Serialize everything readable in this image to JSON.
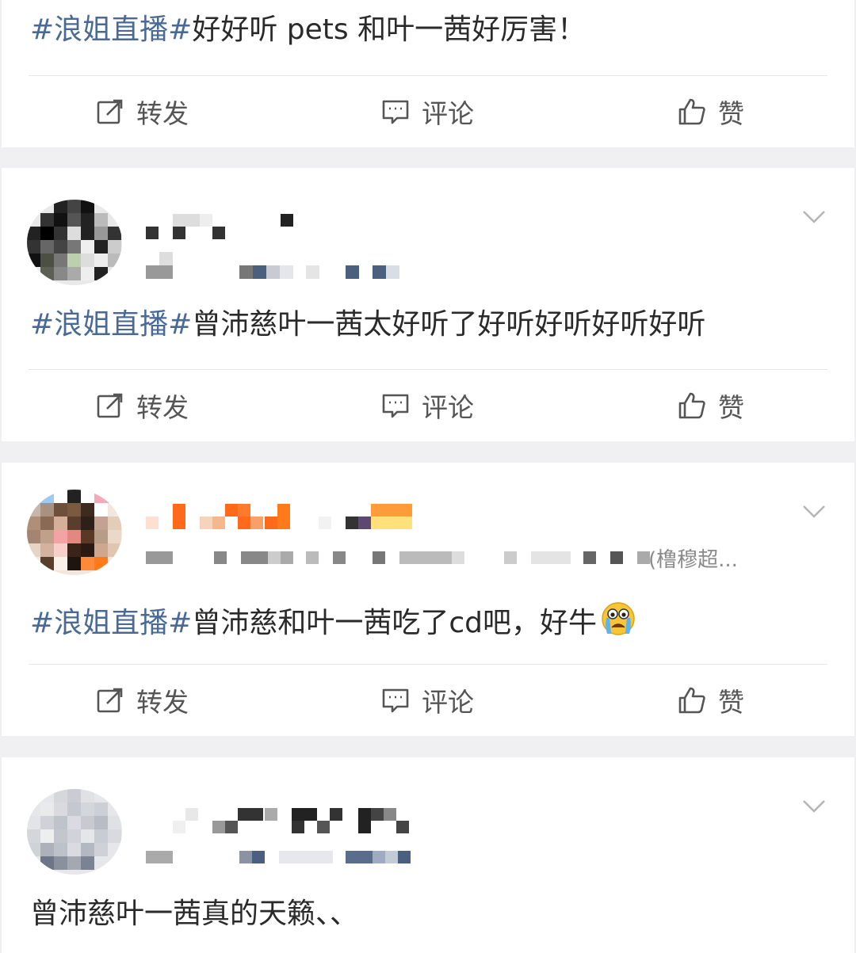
{
  "posts": [
    {
      "tag": "#浪姐直播#",
      "text": "好好听 pets 和叶一茜好厉害！",
      "actions": {
        "repost": "转发",
        "comment": "评论",
        "like": "赞"
      }
    },
    {
      "tag": "#浪姐直播#",
      "text": "曾沛慈叶一茜太好听了好听好听好听好听",
      "actions": {
        "repost": "转发",
        "comment": "评论",
        "like": "赞"
      }
    },
    {
      "tag": "#浪姐直播#",
      "text": "曾沛慈和叶一茜吃了cd吧，好牛",
      "meta_source": "(橹穆超...",
      "emoji": "crying-face",
      "actions": {
        "repost": "转发",
        "comment": "评论",
        "like": "赞"
      }
    },
    {
      "tag": "",
      "text": "曾沛慈叶一茜真的天籁、、"
    }
  ],
  "colors": {
    "topic_tag": "#4a6a95",
    "text": "#2a2a2a",
    "action_label": "#555555",
    "separator": "#f0f0f2"
  },
  "icons": {
    "repost": "repost-icon",
    "comment": "comment-icon",
    "like": "thumbs-up-icon",
    "menu": "chevron-down-icon"
  }
}
